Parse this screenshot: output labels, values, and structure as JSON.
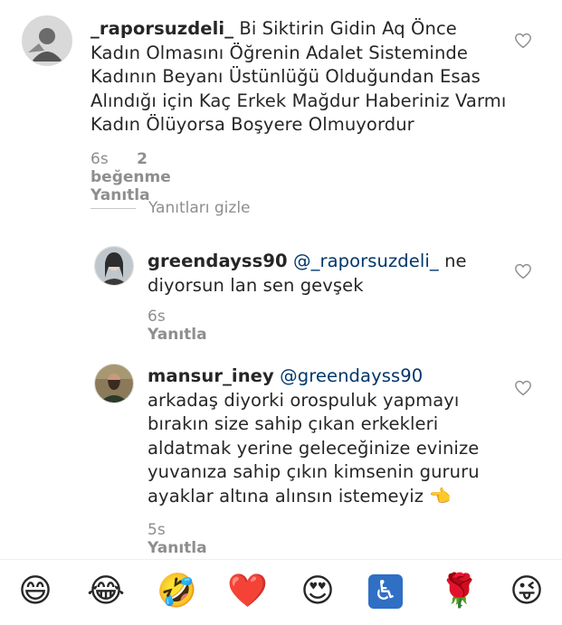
{
  "comments": [
    {
      "username": "_raporsuzdeli_",
      "text": " Bi Siktirin Gidin Aq Önce Kadın Olmasını Öğrenin Adalet Sisteminde Kadının Beyanı Üstünlüğü Olduğundan Esas Alındığı için Kaç Erkek Mağdur Haberiniz Varmı Kadın Ölüyorsa Boşyere Olmuyordur",
      "time": "6s",
      "likes": "2 beğenme",
      "reply": "Yanıtla"
    }
  ],
  "hide_replies": "Yanıtları gizle",
  "replies": [
    {
      "username": "greendayss90",
      "mention": "@_raporsuzdeli_",
      "text": " ne diyorsun lan sen gevşek",
      "time": "6s",
      "reply": "Yanıtla"
    },
    {
      "username": "mansur_iney",
      "mention": "@greendayss90",
      "text": "arkadaş diyorki orospuluk yapmayı bırakın size sahip çıkan erkekleri aldatmak yerine geleceğinize evinize yuvanıza sahip çıkın kimsenin gururu ayaklar altına alınsın istemeyiz 👈",
      "time": "5s",
      "reply": "Yanıtla"
    }
  ],
  "reactions": [
    "😄",
    "😂",
    "🤣",
    "❤️",
    "😍",
    "♿",
    "🌹",
    "😜"
  ]
}
